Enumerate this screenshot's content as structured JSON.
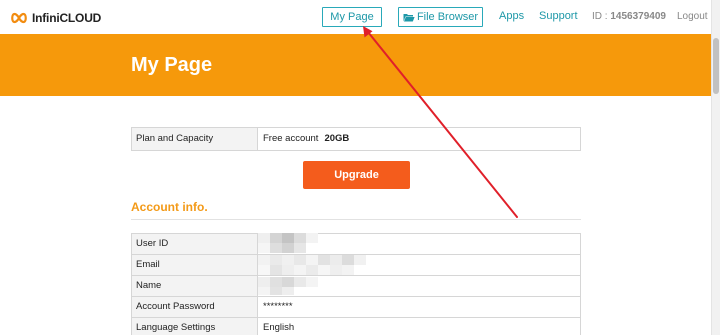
{
  "header": {
    "logo_text": "InfiniCLOUD",
    "nav": {
      "my_page": "My Page",
      "file_browser": "File Browser",
      "apps": "Apps",
      "support": "Support"
    },
    "user_id_label": "ID : ",
    "user_id_value": "1456379409",
    "logout": "Logout"
  },
  "banner": {
    "title": "My Page",
    "color": "#f6990b"
  },
  "plan": {
    "label": "Plan and Capacity",
    "plan_name": "Free account",
    "capacity": "20GB"
  },
  "upgrade_button": "Upgrade",
  "account_section": {
    "title": "Account info.",
    "rows": [
      {
        "label": "User ID",
        "value": ""
      },
      {
        "label": "Email",
        "value": ""
      },
      {
        "label": "Name",
        "value": ""
      },
      {
        "label": "Account Password",
        "value": "********"
      },
      {
        "label": "Language Settings",
        "value": "English"
      }
    ]
  },
  "colors": {
    "accent_teal": "#1e98a8",
    "orange_banner": "#f6990b",
    "upgrade_button": "#f45c1c",
    "section_title": "#f39a18",
    "annotation_arrow": "#e0202a"
  }
}
